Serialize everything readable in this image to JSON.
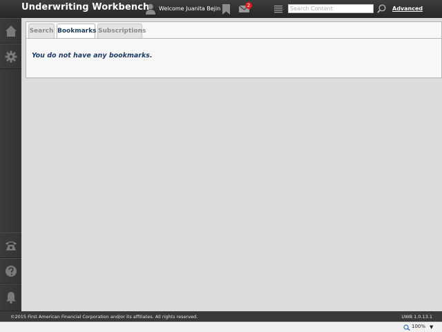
{
  "header": {
    "app_title": "Underwriting Workbench",
    "welcome_text": "Welcome Juanita Bejin",
    "mail_count": "2",
    "search_placeholder": "Search Content",
    "search_value": "",
    "advanced_label": "Advanced"
  },
  "sidebar": {
    "top_items": [
      {
        "icon": "home-icon"
      },
      {
        "icon": "gear-icon"
      }
    ],
    "bottom_items": [
      {
        "icon": "phone-icon"
      },
      {
        "icon": "help-icon"
      },
      {
        "icon": "bell-icon"
      }
    ]
  },
  "tabs": [
    {
      "label": "Search",
      "active": false
    },
    {
      "label": "Bookmarks",
      "active": true
    },
    {
      "label": "Subscriptions",
      "active": false
    }
  ],
  "main": {
    "empty_message": "You do not have any bookmarks."
  },
  "footer": {
    "copyright": "©2015 First American Financial Corporation and/or its affiliates. All rights reserved.",
    "version": "UWB 1.0.13.1"
  },
  "statusbar": {
    "zoom": "100%",
    "zoom_arrow": "▼"
  },
  "colors": {
    "header_bg": "#2f2f2f",
    "accent_text": "#1c3a66",
    "badge": "#d81e1e"
  }
}
